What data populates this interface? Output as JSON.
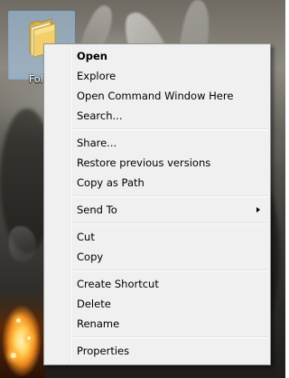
{
  "desktop": {
    "icon": {
      "label": "Fol",
      "icon_name": "folder-icon"
    }
  },
  "context_menu": {
    "groups": [
      {
        "items": [
          {
            "label": "Open",
            "bold": true
          },
          {
            "label": "Explore"
          },
          {
            "label": "Open Command Window Here"
          },
          {
            "label": "Search..."
          }
        ]
      },
      {
        "items": [
          {
            "label": "Share..."
          },
          {
            "label": "Restore previous versions"
          },
          {
            "label": "Copy as Path"
          }
        ]
      },
      {
        "items": [
          {
            "label": "Send To",
            "submenu": true
          }
        ]
      },
      {
        "items": [
          {
            "label": "Cut"
          },
          {
            "label": "Copy"
          }
        ]
      },
      {
        "items": [
          {
            "label": "Create Shortcut"
          },
          {
            "label": "Delete"
          },
          {
            "label": "Rename"
          }
        ]
      },
      {
        "items": [
          {
            "label": "Properties"
          }
        ]
      }
    ]
  },
  "colors": {
    "menu_background": "#f0f0f0",
    "menu_border": "#979797",
    "icon_selection": "#a7cdf0",
    "folder_yellow": "#f2cf6a"
  }
}
